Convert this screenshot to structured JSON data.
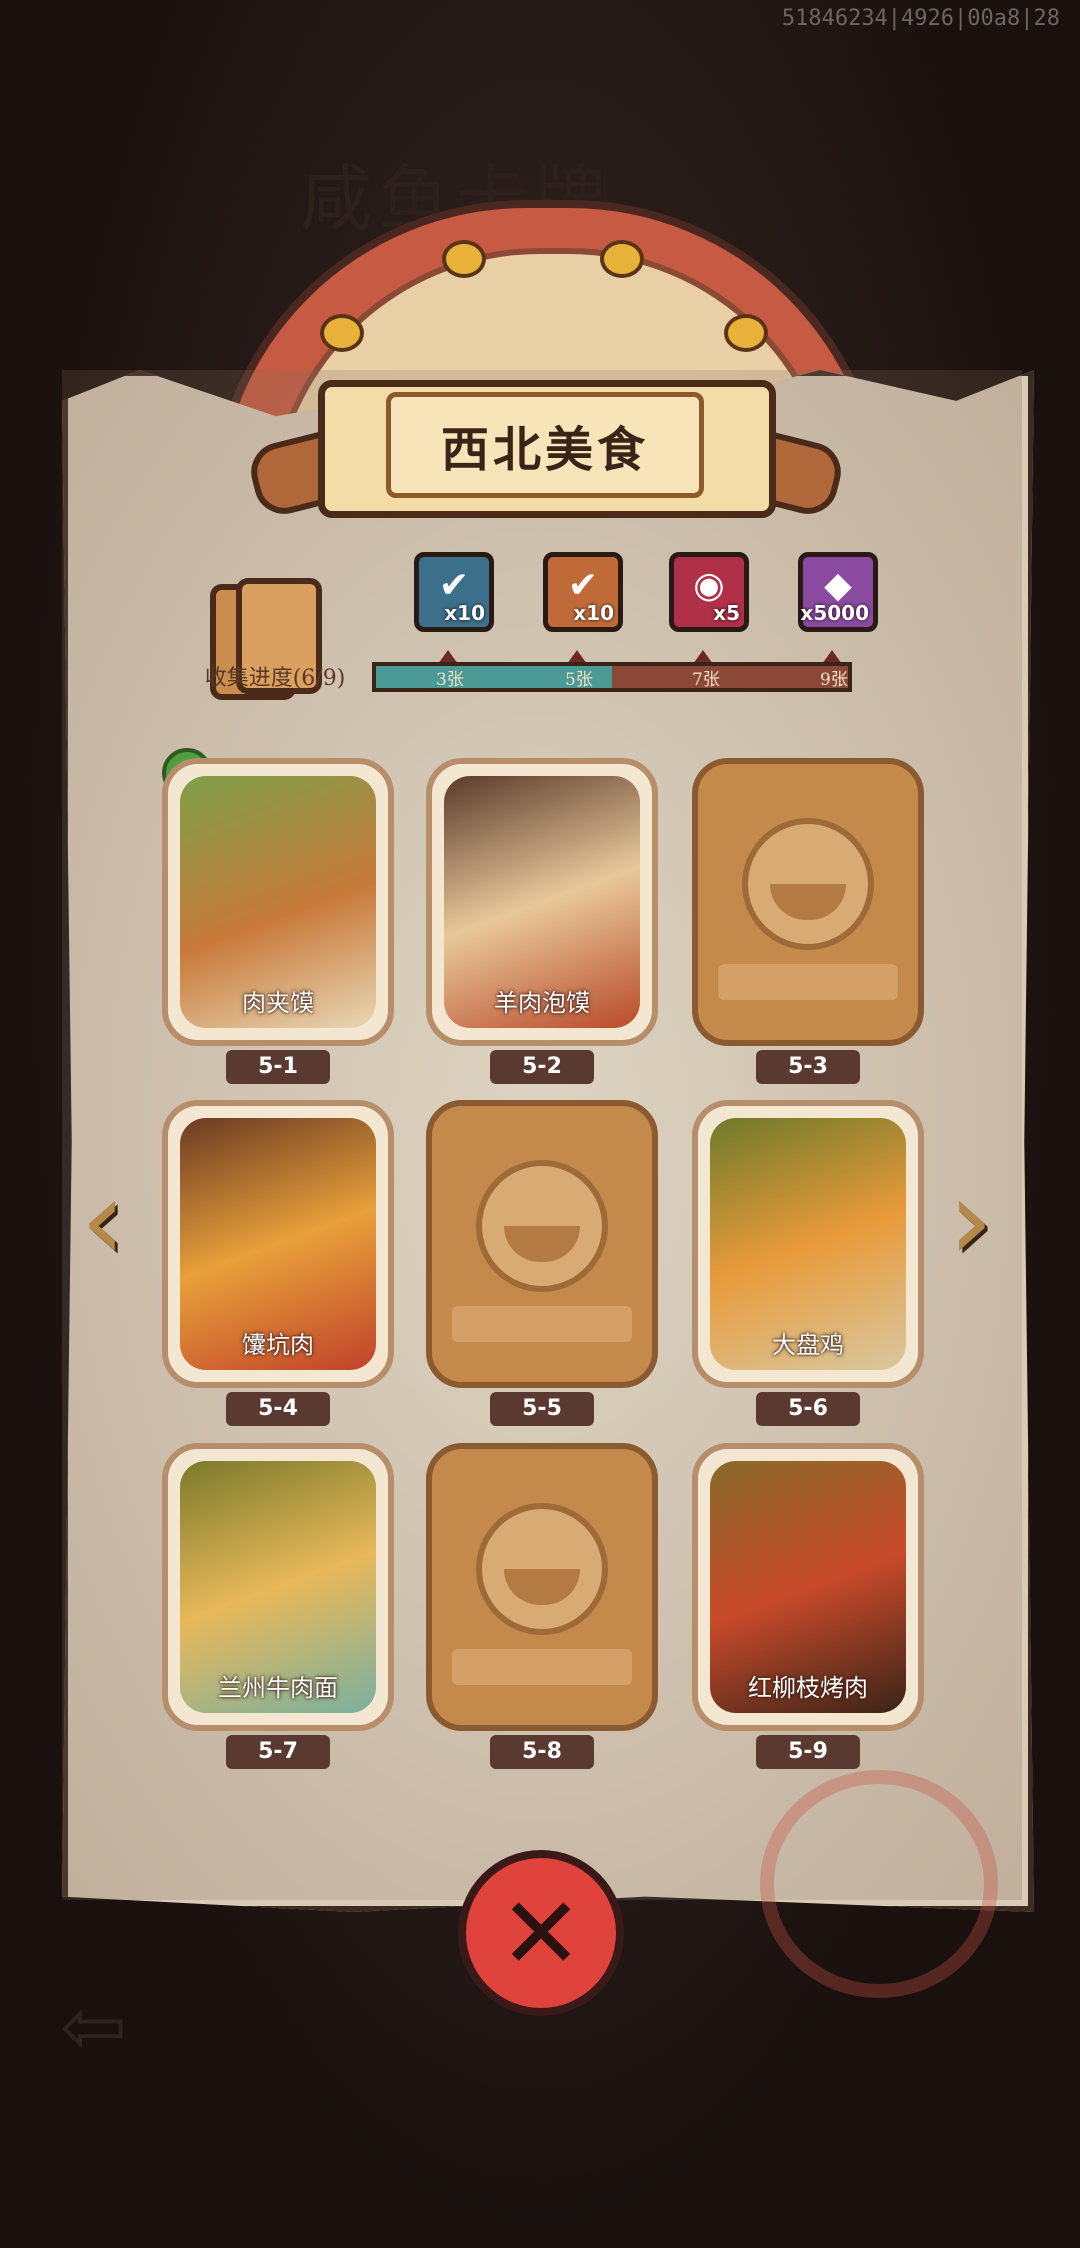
{
  "debug_id": "51846234|4926|00a8|28",
  "background_title": "咸鱼卡牌",
  "album": {
    "title": "西北美食",
    "progress_label": "收集进度(6/9)",
    "progress_fraction": 0.5
  },
  "rewards": [
    {
      "icon": "chest-icon",
      "count": "x10",
      "color": "#3c6f8a"
    },
    {
      "icon": "ticket-icon",
      "count": "x10",
      "color": "#c06a38"
    },
    {
      "icon": "disc-icon",
      "count": "x5",
      "color": "#b03048"
    },
    {
      "icon": "crystal-icon",
      "count": "x5000",
      "color": "#8a4aa0"
    }
  ],
  "milestones": [
    "3张",
    "5张",
    "7张",
    "9张"
  ],
  "cards": [
    {
      "id": "5-1",
      "name": "肉夹馍",
      "collected": true
    },
    {
      "id": "5-2",
      "name": "羊肉泡馍",
      "collected": true
    },
    {
      "id": "5-3",
      "name": "",
      "collected": false
    },
    {
      "id": "5-4",
      "name": "馕坑肉",
      "collected": true
    },
    {
      "id": "5-5",
      "name": "",
      "collected": false
    },
    {
      "id": "5-6",
      "name": "大盘鸡",
      "collected": true
    },
    {
      "id": "5-7",
      "name": "兰州牛肉面",
      "collected": true
    },
    {
      "id": "5-8",
      "name": "",
      "collected": false
    },
    {
      "id": "5-9",
      "name": "红柳枝烤肉",
      "collected": true
    }
  ],
  "nav": {
    "prev_icon": "chevron-left-icon",
    "next_icon": "chevron-right-icon"
  },
  "close_icon": "close-icon"
}
